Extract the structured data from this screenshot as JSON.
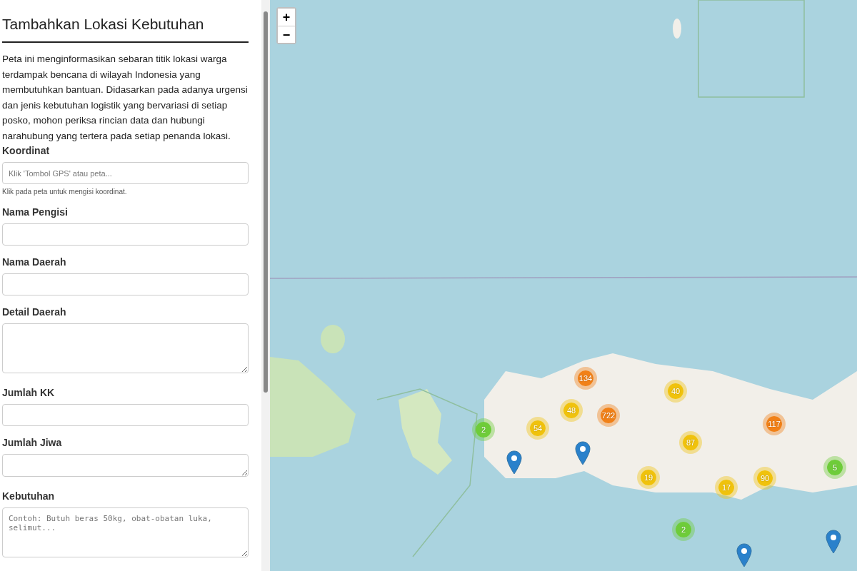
{
  "sidebar": {
    "title": "Tambahkan Lokasi Kebutuhan",
    "description": "Peta ini menginformasikan sebaran titik lokasi warga terdampak bencana di wilayah Indonesia yang membutuhkan bantuan. Didasarkan pada adanya urgensi dan jenis kebutuhan logistik yang bervariasi di setiap posko, mohon periksa rincian data dan hubungi narahubung yang tertera pada setiap penanda lokasi.",
    "fields": [
      {
        "label": "Koordinat",
        "kind": "input",
        "placeholder": "Klik 'Tombol GPS' atau peta...",
        "hint": "Klik pada peta untuk mengisi koordinat."
      },
      {
        "label": "Nama Pengisi",
        "kind": "input"
      },
      {
        "label": "Nama Daerah",
        "kind": "input"
      },
      {
        "label": "Detail Daerah",
        "kind": "textarea"
      },
      {
        "label": "Jumlah KK",
        "kind": "input"
      },
      {
        "label": "Jumlah Jiwa",
        "kind": "textarea-short"
      },
      {
        "label": "Kebutuhan",
        "kind": "textarea",
        "placeholder": "Contoh: Butuh beras 50kg, obat-obatan luka, selimut..."
      }
    ]
  },
  "map": {
    "zoom_in": "+",
    "zoom_out": "−",
    "clusters": [
      {
        "count": "134",
        "color": "#f18017"
      },
      {
        "count": "40",
        "color": "#f0c20c"
      },
      {
        "count": "48",
        "color": "#f0c20c"
      },
      {
        "count": "722",
        "color": "#f18017"
      },
      {
        "count": "54",
        "color": "#f0c20c"
      },
      {
        "count": "2",
        "color": "#6ecc39"
      },
      {
        "count": "117",
        "color": "#f18017"
      },
      {
        "count": "87",
        "color": "#f0c20c"
      },
      {
        "count": "19",
        "color": "#f0c20c"
      },
      {
        "count": "90",
        "color": "#f0c20c"
      },
      {
        "count": "17",
        "color": "#f0c20c"
      },
      {
        "count": "5",
        "color": "#6ecc39"
      },
      {
        "count": "2",
        "color": "#6ecc39"
      }
    ],
    "pins": [
      {
        "kind": "pin"
      },
      {
        "kind": "pin"
      },
      {
        "kind": "pin"
      },
      {
        "kind": "pin"
      }
    ]
  }
}
